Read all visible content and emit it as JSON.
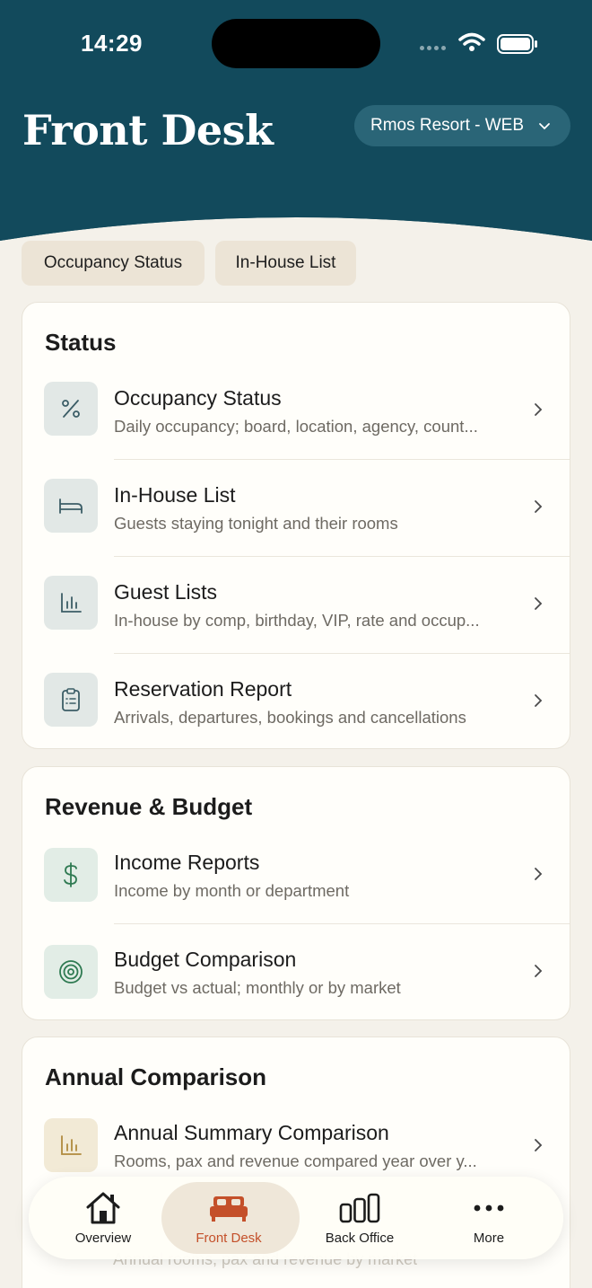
{
  "status_bar": {
    "time": "14:29"
  },
  "header": {
    "title": "Front Desk",
    "resort_picker": "Rmos Resort - WEB",
    "bg_color": "#124a5c"
  },
  "chips": [
    "Occupancy Status",
    "In-House List"
  ],
  "sections": [
    {
      "title": "Status",
      "items": [
        {
          "title": "Occupancy Status",
          "subtitle": "Daily occupancy; board, location, agency, count...",
          "icon": "percent-icon"
        },
        {
          "title": "In-House List",
          "subtitle": "Guests staying tonight and their rooms",
          "icon": "bed-icon"
        },
        {
          "title": "Guest Lists",
          "subtitle": "In-house by comp, birthday, VIP, rate and occup...",
          "icon": "bar-chart-icon"
        },
        {
          "title": "Reservation Report",
          "subtitle": "Arrivals, departures, bookings and cancellations",
          "icon": "clipboard-icon"
        }
      ]
    },
    {
      "title": "Revenue & Budget",
      "items": [
        {
          "title": "Income Reports",
          "subtitle": "Income by month or department",
          "icon": "dollar-icon"
        },
        {
          "title": "Budget Comparison",
          "subtitle": "Budget vs actual; monthly or by market",
          "icon": "target-icon"
        }
      ]
    },
    {
      "title": "Annual Comparison",
      "items": [
        {
          "title": "Annual Summary Comparison",
          "subtitle": "Rooms, pax and revenue compared year over y...",
          "icon": "bar-chart-icon"
        }
      ],
      "partially_hidden_subtitle": "Annual rooms, pax and revenue by market"
    }
  ],
  "tabbar": {
    "tabs": [
      {
        "label": "Overview",
        "icon": "house-icon"
      },
      {
        "label": "Front Desk",
        "icon": "bed-icon",
        "active": true
      },
      {
        "label": "Back Office",
        "icon": "columns-icon"
      },
      {
        "label": "More",
        "icon": "ellipsis-icon"
      }
    ],
    "active_color": "#c4502a"
  }
}
